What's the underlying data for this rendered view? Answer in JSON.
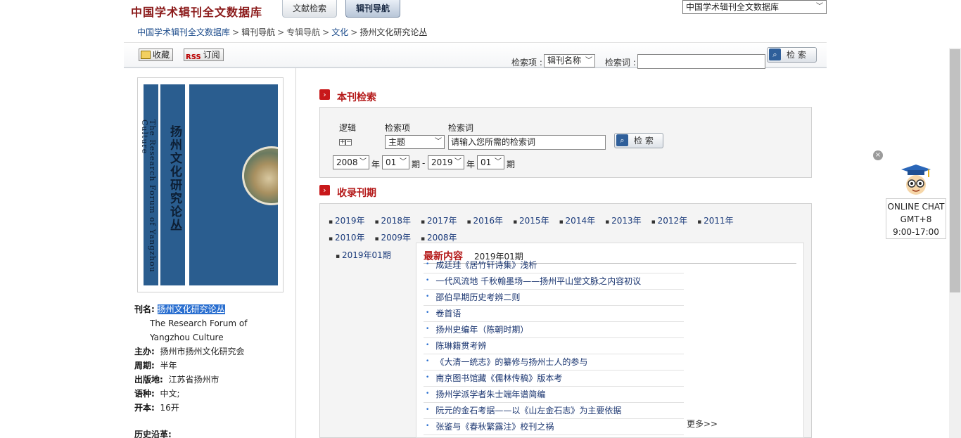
{
  "header": {
    "logo": "中国学术辑刊全文数据库",
    "tabs": [
      {
        "label": "文献检索",
        "active": false
      },
      {
        "label": "辑刊导航",
        "active": true
      }
    ],
    "db_select": "中国学术辑刊全文数据库"
  },
  "breadcrumb": {
    "items": [
      "中国学术辑刊全文数据库",
      "辑刊导航",
      "专辑导航",
      "文化",
      "扬州文化研究论丛"
    ],
    "separator": ">"
  },
  "toolbar": {
    "favorite_label": "收藏",
    "rss_badge": "RSS",
    "subscribe_label": "订阅",
    "search_field_label": "检索项 :",
    "search_field_value": "辑刊名称",
    "search_word_label": "检索词 :",
    "search_word_value": "",
    "search_button": "检 索"
  },
  "journal": {
    "cover_title_en": "The Research Forum of Yangzhou Culture",
    "cover_title_cn": "扬州文化研究论丛",
    "name_label": "刊名:",
    "name_value": "扬州文化研究论丛",
    "name_en": "The Research Forum of Yangzhou Culture",
    "sponsor_label": "主办:",
    "sponsor_value": "扬州市扬州文化研究会",
    "period_label": "周期:",
    "period_value": "半年",
    "place_label": "出版地:",
    "place_value": "江苏省扬州市",
    "lang_label": "语种:",
    "lang_value": "中文;",
    "format_label": "开本:",
    "format_value": "16开",
    "history_label": "历史沿革:"
  },
  "journal_search": {
    "title": "本刊检索",
    "logic_label": "逻辑",
    "field_label": "检索项",
    "word_label": "检索词",
    "plus": "⊞",
    "minus": "⊟",
    "field_value": "主题",
    "word_value": "请输入您所需的检索词",
    "button": "检 索",
    "from_year": "2008",
    "year_sep": "年",
    "from_issue": "01",
    "issue_sep": "期",
    "dash": "-",
    "to_year": "2019",
    "to_issue": "01"
  },
  "issues": {
    "title": "收录刊期",
    "years": [
      "2019年",
      "2018年",
      "2017年",
      "2016年",
      "2015年",
      "2014年",
      "2013年",
      "2012年",
      "2011年",
      "2010年",
      "2009年",
      "2008年"
    ],
    "selected_year_issues": [
      "2019年01期"
    ]
  },
  "latest": {
    "title": "最新内容",
    "issue": "2019年01期",
    "articles": [
      "成廷珪《居竹轩诗集》浅析",
      "一代风流地 千秋翰墨场——扬州平山堂文脉之内容初议",
      "邵伯早期历史考辨二则",
      "卷首语",
      "扬州史编年（陈朝时期）",
      "陈琳籍贯考辨",
      "《大清一统志》的纂修与扬州士人的参与",
      "南京图书馆藏《儒林传稿》版本考",
      "扬州学派学者朱士端年谱简编",
      "阮元的金石考据——以《山左金石志》为主要依据",
      "张鉴与《春秋繁露注》校刊之祸"
    ],
    "more": "更多>>"
  },
  "chat": {
    "close": "×",
    "line1": "ONLINE CHAT",
    "line2": "GMT+8",
    "line3": "9:00-17:00"
  }
}
